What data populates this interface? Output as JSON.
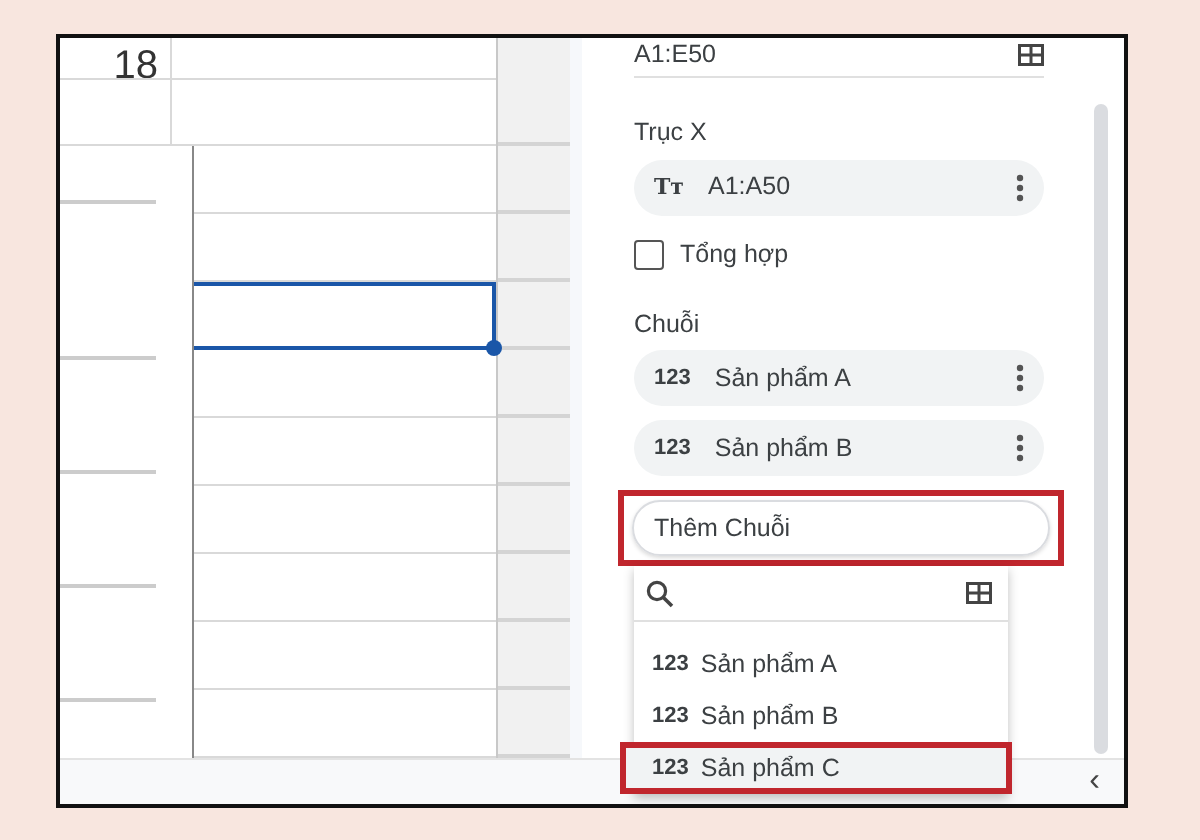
{
  "sheet": {
    "top_cell": "18",
    "rows": [
      {
        "selected": false
      },
      {
        "selected": false
      },
      {
        "selected": true
      },
      {
        "selected": false
      },
      {
        "selected": false
      },
      {
        "selected": false
      },
      {
        "selected": false
      },
      {
        "selected": false
      },
      {
        "selected": false
      }
    ]
  },
  "sidebar": {
    "data_range": "A1:E50",
    "x_axis": {
      "label": "Trục X",
      "chip": {
        "kind": "text",
        "type_label": "Tт",
        "label": "A1:A50"
      }
    },
    "aggregate": {
      "label": "Tổng hợp",
      "checked": false
    },
    "series": {
      "label": "Chuỗi",
      "chips": [
        {
          "kind": "number",
          "type_label": "123",
          "label": "Sản phẩm A"
        },
        {
          "kind": "number",
          "type_label": "123",
          "label": "Sản phẩm B"
        }
      ]
    },
    "add_series": {
      "label": "Thêm Chuỗi",
      "highlighted": true
    },
    "dropdown": {
      "items": [
        {
          "type_label": "123",
          "label": "Sản phẩm A",
          "selected": false,
          "highlighted": false
        },
        {
          "type_label": "123",
          "label": "Sản phẩm B",
          "selected": false,
          "highlighted": false
        },
        {
          "type_label": "123",
          "label": "Sản phẩm C",
          "selected": true,
          "highlighted": true
        }
      ]
    },
    "collapse": "‹"
  }
}
